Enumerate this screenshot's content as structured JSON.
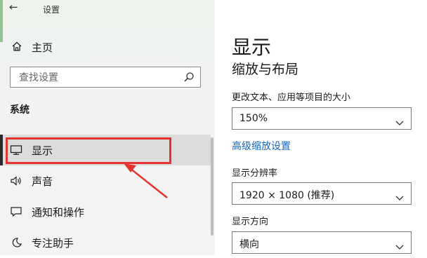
{
  "window": {
    "title": "设置",
    "back_glyph": "←"
  },
  "sidebar": {
    "home_label": "主页",
    "search_placeholder": "查找设置",
    "section_title": "系统",
    "items": [
      {
        "label": "显示",
        "icon": "monitor-icon",
        "selected": true
      },
      {
        "label": "声音",
        "icon": "speaker-icon",
        "selected": false
      },
      {
        "label": "通知和操作",
        "icon": "notification-icon",
        "selected": false
      },
      {
        "label": "专注助手",
        "icon": "moon-icon",
        "selected": false
      }
    ]
  },
  "main": {
    "title": "显示",
    "subtitle": "缩放与布局",
    "scale_label": "更改文本、应用等项目的大小",
    "scale_value": "150%",
    "advanced_scaling_link": "高级缩放设置",
    "resolution_label": "显示分辨率",
    "resolution_value": "1920 × 1080 (推荐)",
    "orientation_label": "显示方向",
    "orientation_value": "横向"
  },
  "colors": {
    "annotation": "#e3342f",
    "link": "#1565c0",
    "selected_bg": "#dcdcdc"
  }
}
